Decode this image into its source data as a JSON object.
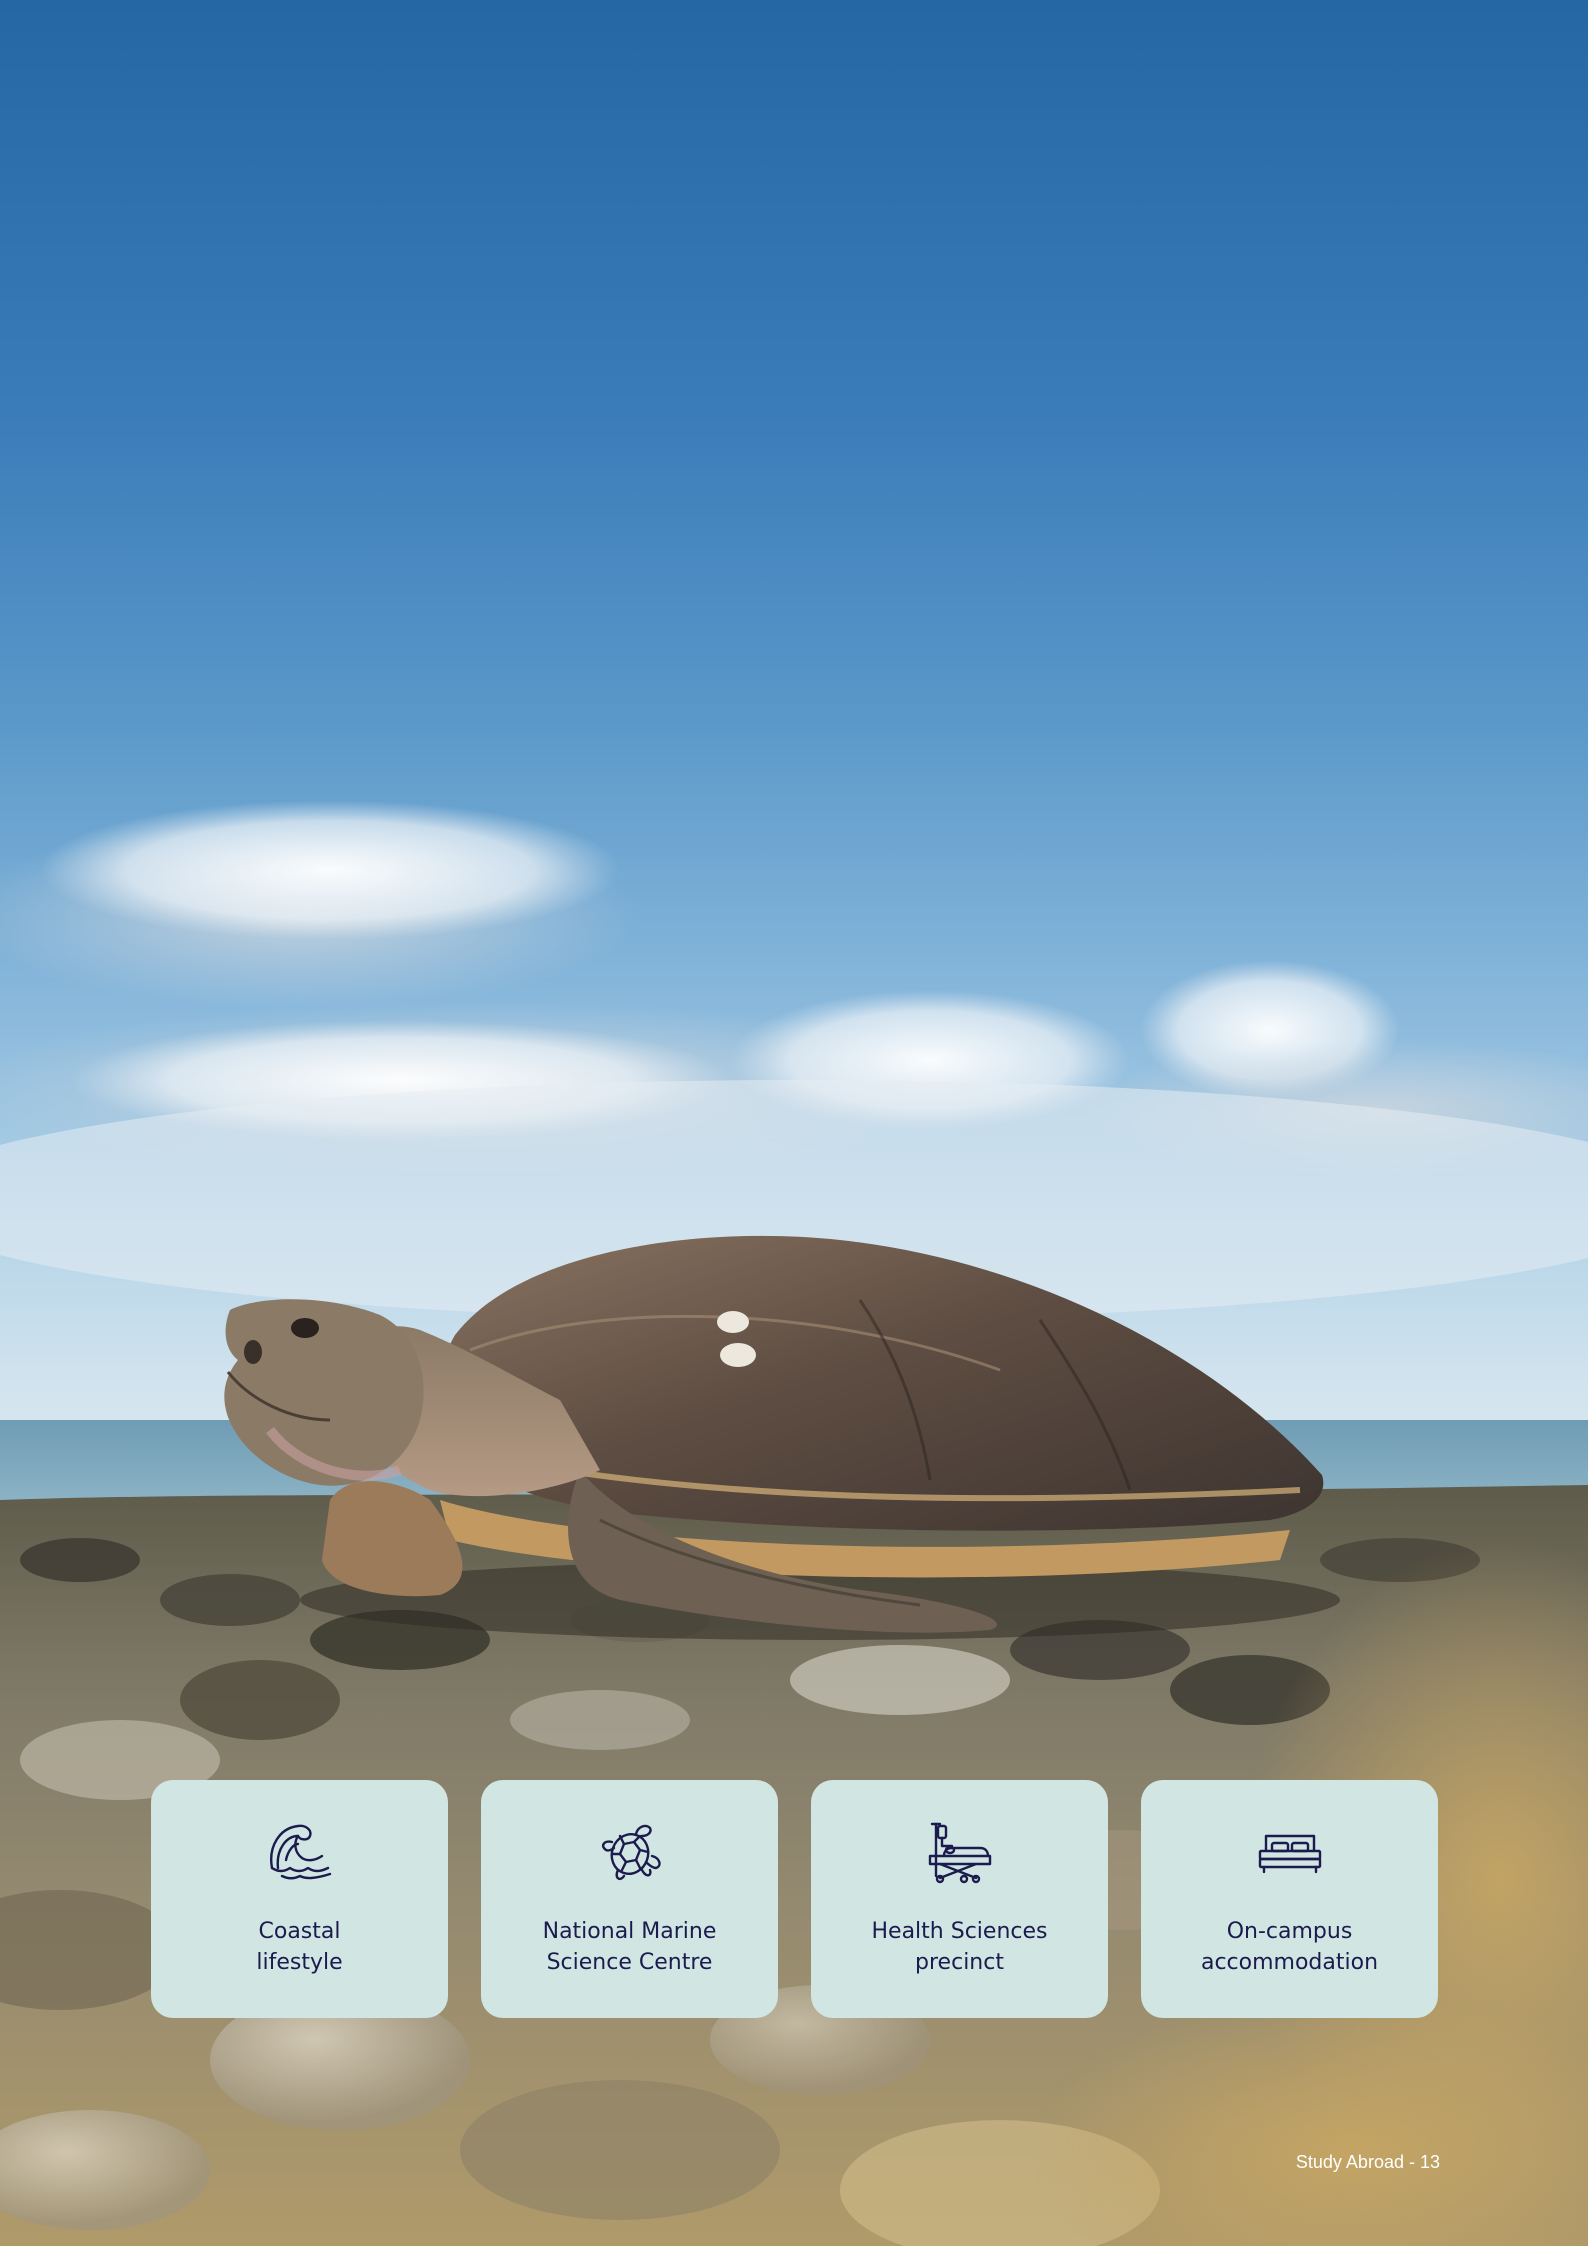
{
  "features": [
    {
      "label": "Coastal\nlifestyle",
      "icon": "wave-icon"
    },
    {
      "label": "National Marine\nScience Centre",
      "icon": "turtle-icon"
    },
    {
      "label": "Health Sciences\nprecinct",
      "icon": "hospital-bed-icon"
    },
    {
      "label": "On-campus\naccommodation",
      "icon": "bed-icon"
    }
  ],
  "footer": {
    "text": "Study Abroad - 13"
  },
  "colors": {
    "card_bg": "#d1e5e3",
    "icon_text": "#1c1b4d",
    "sky": "#2566a4"
  }
}
